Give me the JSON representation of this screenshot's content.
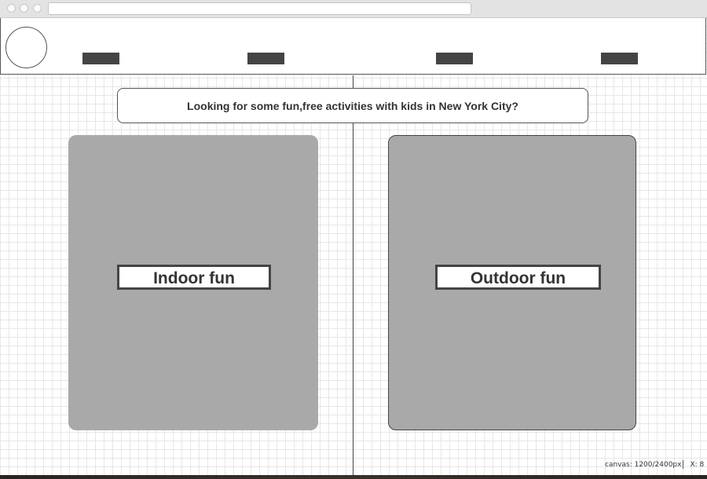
{
  "header": {
    "nav_items": [
      "",
      "",
      "",
      ""
    ]
  },
  "banner": {
    "text": "Looking for some fun,free activities with kids in New York City?"
  },
  "cards": {
    "indoor": {
      "label": "Indoor fun"
    },
    "outdoor": {
      "label": "Outdoor fun"
    }
  },
  "status": {
    "canvas": "canvas: 1200/2400px",
    "x": "X: 8"
  },
  "colors": {
    "card_fill": "#a9a9a9",
    "nav_fill": "#444444",
    "grid": "#e7e7e7"
  }
}
